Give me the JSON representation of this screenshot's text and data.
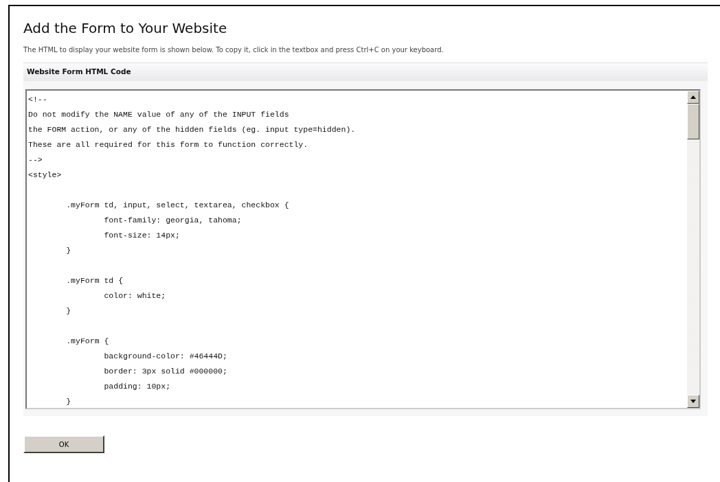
{
  "page": {
    "title": "Add the Form to Your Website",
    "description": "The HTML to display your website form is shown below. To copy it, click in the textbox and press Ctrl+C on your keyboard."
  },
  "panel": {
    "header": "Website Form HTML Code",
    "code_blocks": [
      [
        "<!--",
        "Do not modify the NAME value of any of the INPUT fields",
        "the FORM action, or any of the hidden fields (eg. input type=hidden).",
        "These are all required for this form to function correctly.",
        "-->",
        "<style>"
      ],
      [
        "\t.myForm td, input, select, textarea, checkbox {",
        "\t\tfont-family: georgia, tahoma;",
        "\t\tfont-size: 14px;",
        "\t}"
      ],
      [
        "\t.myForm td {",
        "\t\tcolor: white;",
        "\t}"
      ],
      [
        "\t.myForm {",
        "\t\tbackground-color: #46444D;",
        "\t\tborder: 3px solid #000000;",
        "\t\tpadding: 10px;",
        "\t}"
      ]
    ]
  },
  "buttons": [
    {
      "label": "OK"
    }
  ]
}
